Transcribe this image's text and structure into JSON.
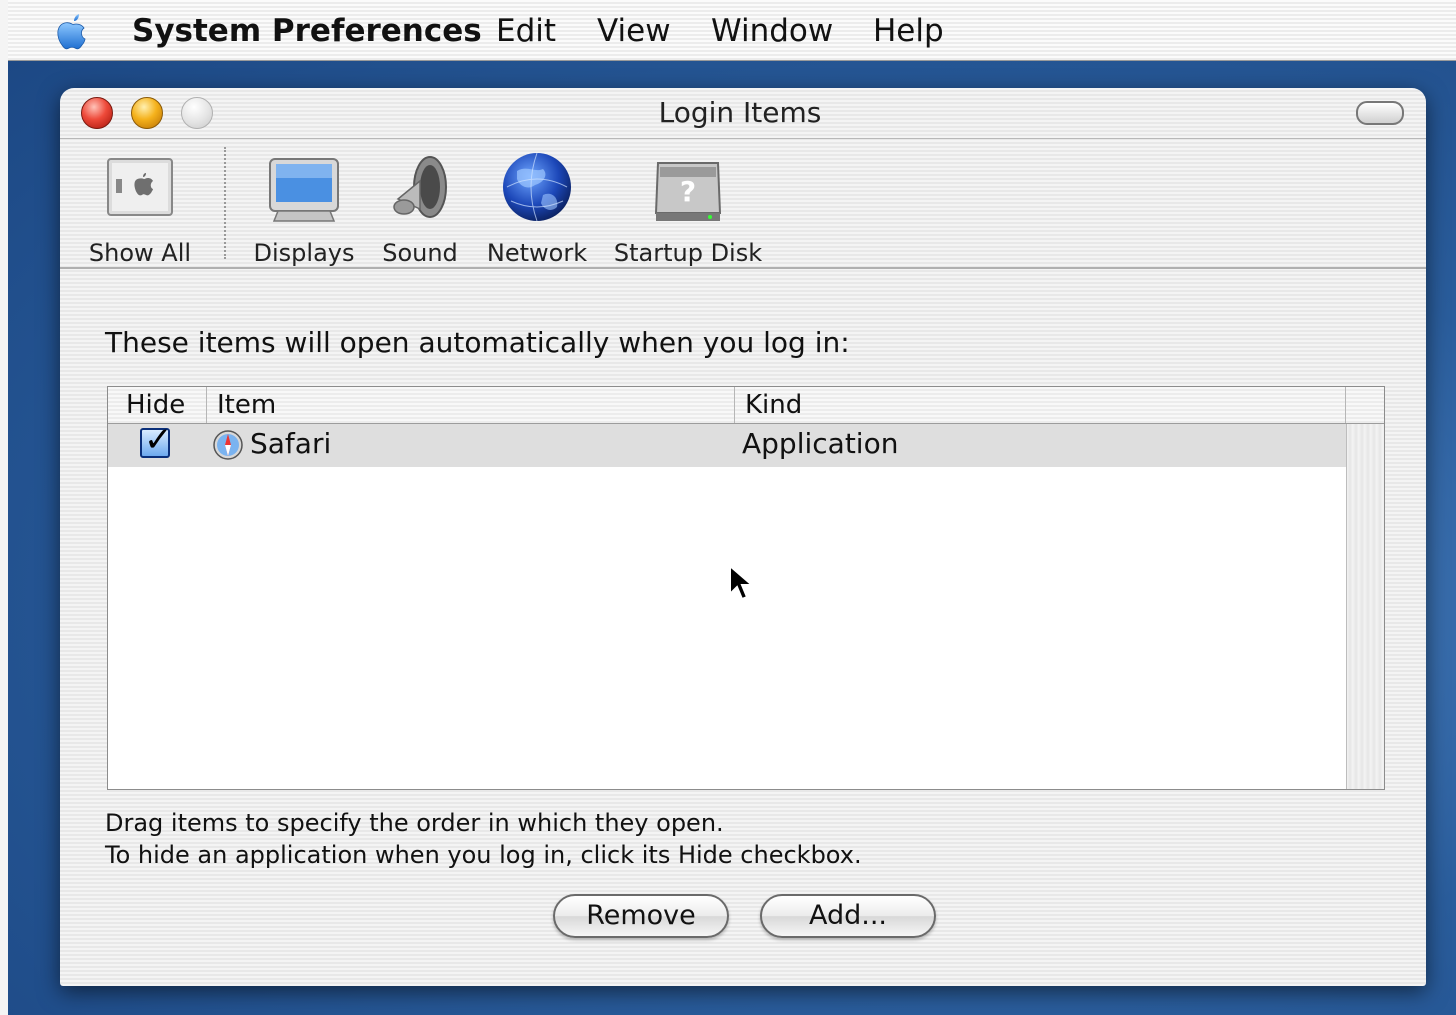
{
  "menubar": {
    "app_name": "System Preferences",
    "items": [
      "Edit",
      "View",
      "Window",
      "Help"
    ],
    "apple_icon": "apple-logo-icon"
  },
  "window": {
    "title": "Login Items"
  },
  "toolbar": {
    "items": [
      {
        "label": "Show All",
        "icon": "show-all-icon"
      },
      {
        "label": "Displays",
        "icon": "display-icon"
      },
      {
        "label": "Sound",
        "icon": "speaker-icon"
      },
      {
        "label": "Network",
        "icon": "globe-icon"
      },
      {
        "label": "Startup Disk",
        "icon": "hard-disk-icon"
      }
    ]
  },
  "content": {
    "intro": "These items will open automatically when you log in:",
    "table": {
      "columns": [
        "Hide",
        "Item",
        "Kind"
      ],
      "rows": [
        {
          "hide": true,
          "item": "Safari",
          "kind": "Application",
          "icon": "safari-compass-icon"
        }
      ]
    },
    "help_line1": "Drag items to specify the order in which they open.",
    "help_line2": "To hide an application when you log in, click its Hide checkbox.",
    "buttons": {
      "remove": "Remove",
      "add": "Add..."
    }
  },
  "colors": {
    "desktop": "#2a5d9c",
    "close": "#ee4a3a",
    "minimize": "#f5b21c",
    "selected_row": "#dedede"
  }
}
